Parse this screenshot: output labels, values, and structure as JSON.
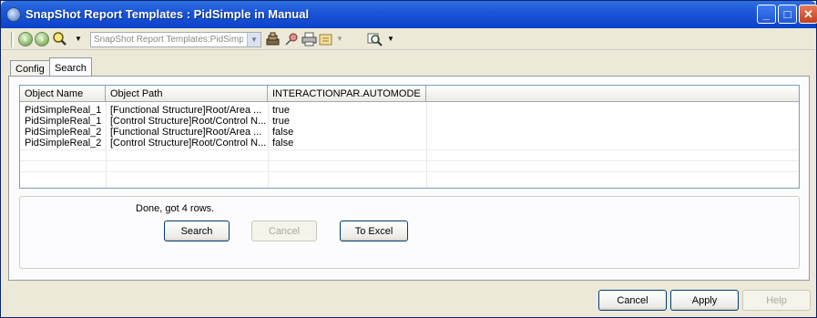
{
  "window": {
    "title": "SnapShot Report Templates : PidSimple in Manual",
    "minimize": "_",
    "maximize": "□",
    "close": "✕"
  },
  "toolbar": {
    "combo_value": "SnapShot Report Templates:PidSimpl"
  },
  "tabs": [
    {
      "label": "Config",
      "active": false
    },
    {
      "label": "Search",
      "active": true
    }
  ],
  "grid": {
    "columns": [
      "Object Name",
      "Object Path",
      "INTERACTIONPAR.AUTOMODE",
      ""
    ],
    "rows": [
      [
        "PidSimpleReal_1",
        "[Functional Structure]Root/Area ...",
        "true"
      ],
      [
        "PidSimpleReal_1",
        "[Control Structure]Root/Control N...",
        "true"
      ],
      [
        "PidSimpleReal_2",
        "[Functional Structure]Root/Area ...",
        "false"
      ],
      [
        "PidSimpleReal_2",
        "[Control Structure]Root/Control N...",
        "false"
      ]
    ]
  },
  "search_panel": {
    "status": "Done, got 4 rows.",
    "search_label": "Search",
    "cancel_label": "Cancel",
    "excel_label": "To Excel"
  },
  "footer": {
    "cancel_label": "Cancel",
    "apply_label": "Apply",
    "help_label": "Help"
  },
  "colors": {
    "titlebar": "#0b43c8",
    "window_bg": "#ece9d8",
    "button_border": "#003c74"
  }
}
